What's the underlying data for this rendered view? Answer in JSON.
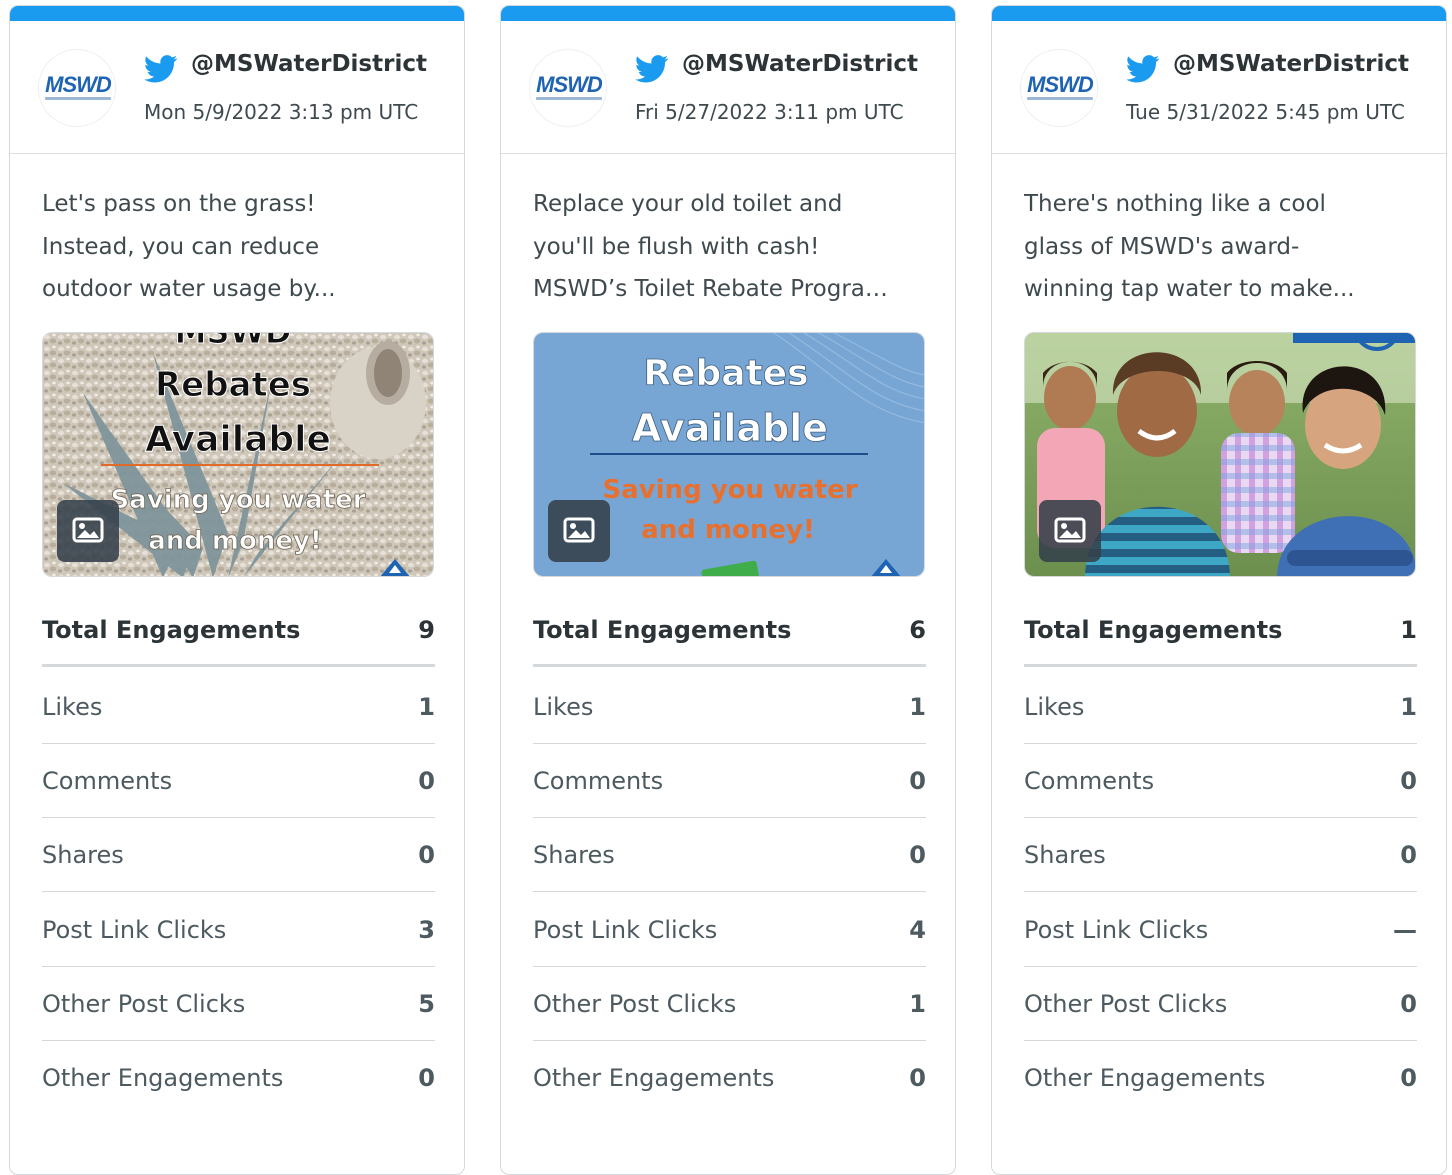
{
  "accent_color": "#1b9bf0",
  "cards": [
    {
      "avatar_logo": "MSWD",
      "icon": "twitter-bird-icon",
      "handle": "@MSWaterDistrict",
      "timestamp": "Mon 5/9/2022 3:13 pm UTC",
      "text_lines": [
        "Let's pass on the grass!",
        "Instead, you can reduce",
        "outdoor water usage by..."
      ],
      "media": {
        "kind": "graphic",
        "lines": [
          "MSWD",
          "Rebates",
          "Available",
          "Saving you water",
          "and money!"
        ]
      },
      "metrics": [
        {
          "label": "Total Engagements",
          "value": "9"
        },
        {
          "label": "Likes",
          "value": "1"
        },
        {
          "label": "Comments",
          "value": "0"
        },
        {
          "label": "Shares",
          "value": "0"
        },
        {
          "label": "Post Link Clicks",
          "value": "3"
        },
        {
          "label": "Other Post Clicks",
          "value": "5"
        },
        {
          "label": "Other Engagements",
          "value": "0"
        }
      ]
    },
    {
      "avatar_logo": "MSWD",
      "icon": "twitter-bird-icon",
      "handle": "@MSWaterDistrict",
      "timestamp": "Fri 5/27/2022 3:11 pm UTC",
      "text_lines": [
        "Replace your old toilet and",
        "you'll be flush with cash!",
        "MSWD’s Toilet Rebate Program..."
      ],
      "media": {
        "kind": "graphic",
        "lines": [
          "Rebates",
          "Available",
          "Saving you water",
          "and money!"
        ]
      },
      "metrics": [
        {
          "label": "Total Engagements",
          "value": "6"
        },
        {
          "label": "Likes",
          "value": "1"
        },
        {
          "label": "Comments",
          "value": "0"
        },
        {
          "label": "Shares",
          "value": "0"
        },
        {
          "label": "Post Link Clicks",
          "value": "4"
        },
        {
          "label": "Other Post Clicks",
          "value": "1"
        },
        {
          "label": "Other Engagements",
          "value": "0"
        }
      ]
    },
    {
      "avatar_logo": "MSWD",
      "icon": "twitter-bird-icon",
      "handle": "@MSWaterDistrict",
      "timestamp": "Tue 5/31/2022 5:45 pm UTC",
      "text_lines": [
        "There's nothing like a cool",
        "glass of MSWD's award-",
        "winning tap water to make..."
      ],
      "media": {
        "kind": "photo",
        "lines": []
      },
      "metrics": [
        {
          "label": "Total Engagements",
          "value": "1"
        },
        {
          "label": "Likes",
          "value": "1"
        },
        {
          "label": "Comments",
          "value": "0"
        },
        {
          "label": "Shares",
          "value": "0"
        },
        {
          "label": "Post Link Clicks",
          "value": "—"
        },
        {
          "label": "Other Post Clicks",
          "value": "0"
        },
        {
          "label": "Other Engagements",
          "value": "0"
        }
      ]
    }
  ]
}
